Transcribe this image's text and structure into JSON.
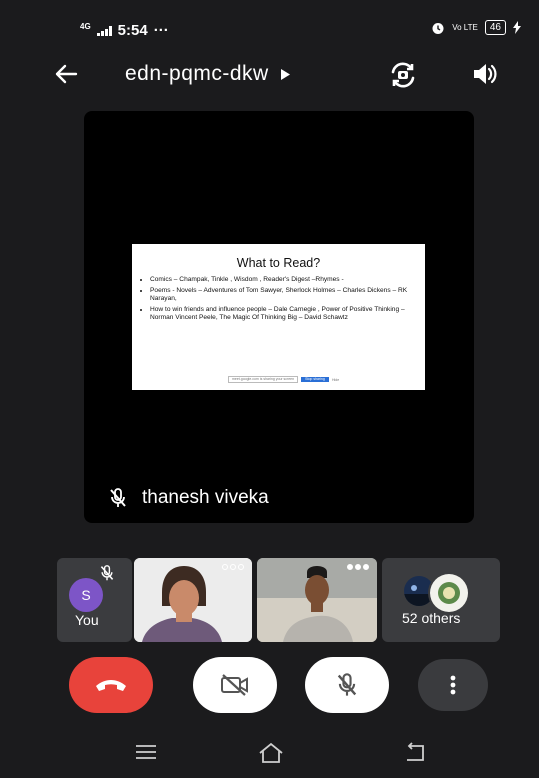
{
  "status_bar": {
    "network": "4G",
    "time": "5:54",
    "notification_dots": "···",
    "volte": "Vo LTE",
    "battery": "46"
  },
  "header": {
    "meeting_code": "edn-pqmc-dkw"
  },
  "main_tile": {
    "slide": {
      "title": "What to Read?",
      "bullets": [
        "Comics – Champak, Tinkle , Wisdom , Reader's Digest –Rhymes -",
        "Poems - Novels – Adventures of Tom Sawyer, Sherlock Holmes – Charles Dickens – RK Narayan,",
        "How to win friends and influence people – Dale Carnegie , Power of Positive Thinking – Norman Vincent Peele, The Magic Of Thinking Big – David Schawtz"
      ],
      "share_bar": {
        "text": "meet.google.com is sharing your screen",
        "stop_button": "Stop sharing",
        "hide_button": "Hide"
      }
    },
    "speaker_name": "thanesh viveka"
  },
  "participants": {
    "you_label": "You",
    "you_initial": "S",
    "others_label": "52 others"
  },
  "icons": {
    "back": "back-arrow-icon",
    "play": "play-triangle-icon",
    "switch_camera": "switch-camera-icon",
    "speaker": "speaker-icon",
    "mic_off": "mic-off-icon",
    "end_call": "end-call-icon",
    "video_off": "video-off-icon",
    "more": "more-vertical-icon"
  },
  "colors": {
    "background": "#1b1b1d",
    "end_call": "#e8433b",
    "avatar": "#7d55c7",
    "share_button": "#2a6fd6"
  }
}
